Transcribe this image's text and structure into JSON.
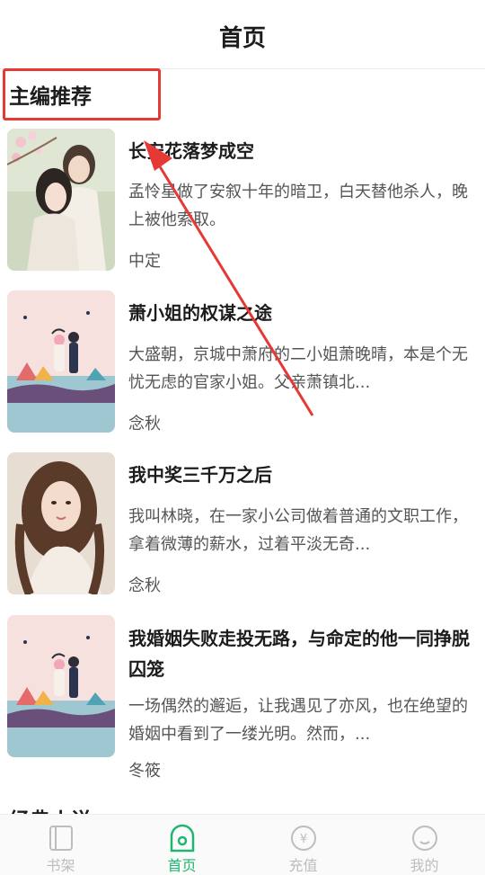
{
  "header": {
    "title": "首页"
  },
  "section": {
    "title": "主编推荐",
    "next_title": "经典小说"
  },
  "books": [
    {
      "title": "长安花落梦成空",
      "desc": "孟怜星做了安叙十年的暗卫，白天替他杀人，晚上被他索取。",
      "author": "中定",
      "cover": "couple-blossom"
    },
    {
      "title": "萧小姐的权谋之途",
      "desc": "大盛朝，京城中萧府的二小姐萧晚晴，本是个无忧无虑的官家小姐。父亲萧镇北...",
      "author": "念秋",
      "cover": "pink-sea"
    },
    {
      "title": "我中奖三千万之后",
      "desc": "我叫林晓，在一家小公司做着普通的文职工作，拿着微薄的薪水，过着平淡无奇...",
      "author": "念秋",
      "cover": "girl-portrait"
    },
    {
      "title": "我婚姻失败走投无路，与命定的他一同挣脱囚笼",
      "desc": "一场偶然的邂逅，让我遇见了亦风，也在绝望的婚姻中看到了一缕光明。然而，...",
      "author": "冬筱",
      "cover": "pink-sea"
    }
  ],
  "tabs": [
    {
      "label": "书架",
      "icon": "bookshelf-icon",
      "active": false
    },
    {
      "label": "首页",
      "icon": "home-icon",
      "active": true
    },
    {
      "label": "充值",
      "icon": "recharge-icon",
      "active": false
    },
    {
      "label": "我的",
      "icon": "profile-icon",
      "active": false
    }
  ],
  "colors": {
    "accent": "#1fb770",
    "annotation": "#e53935"
  }
}
